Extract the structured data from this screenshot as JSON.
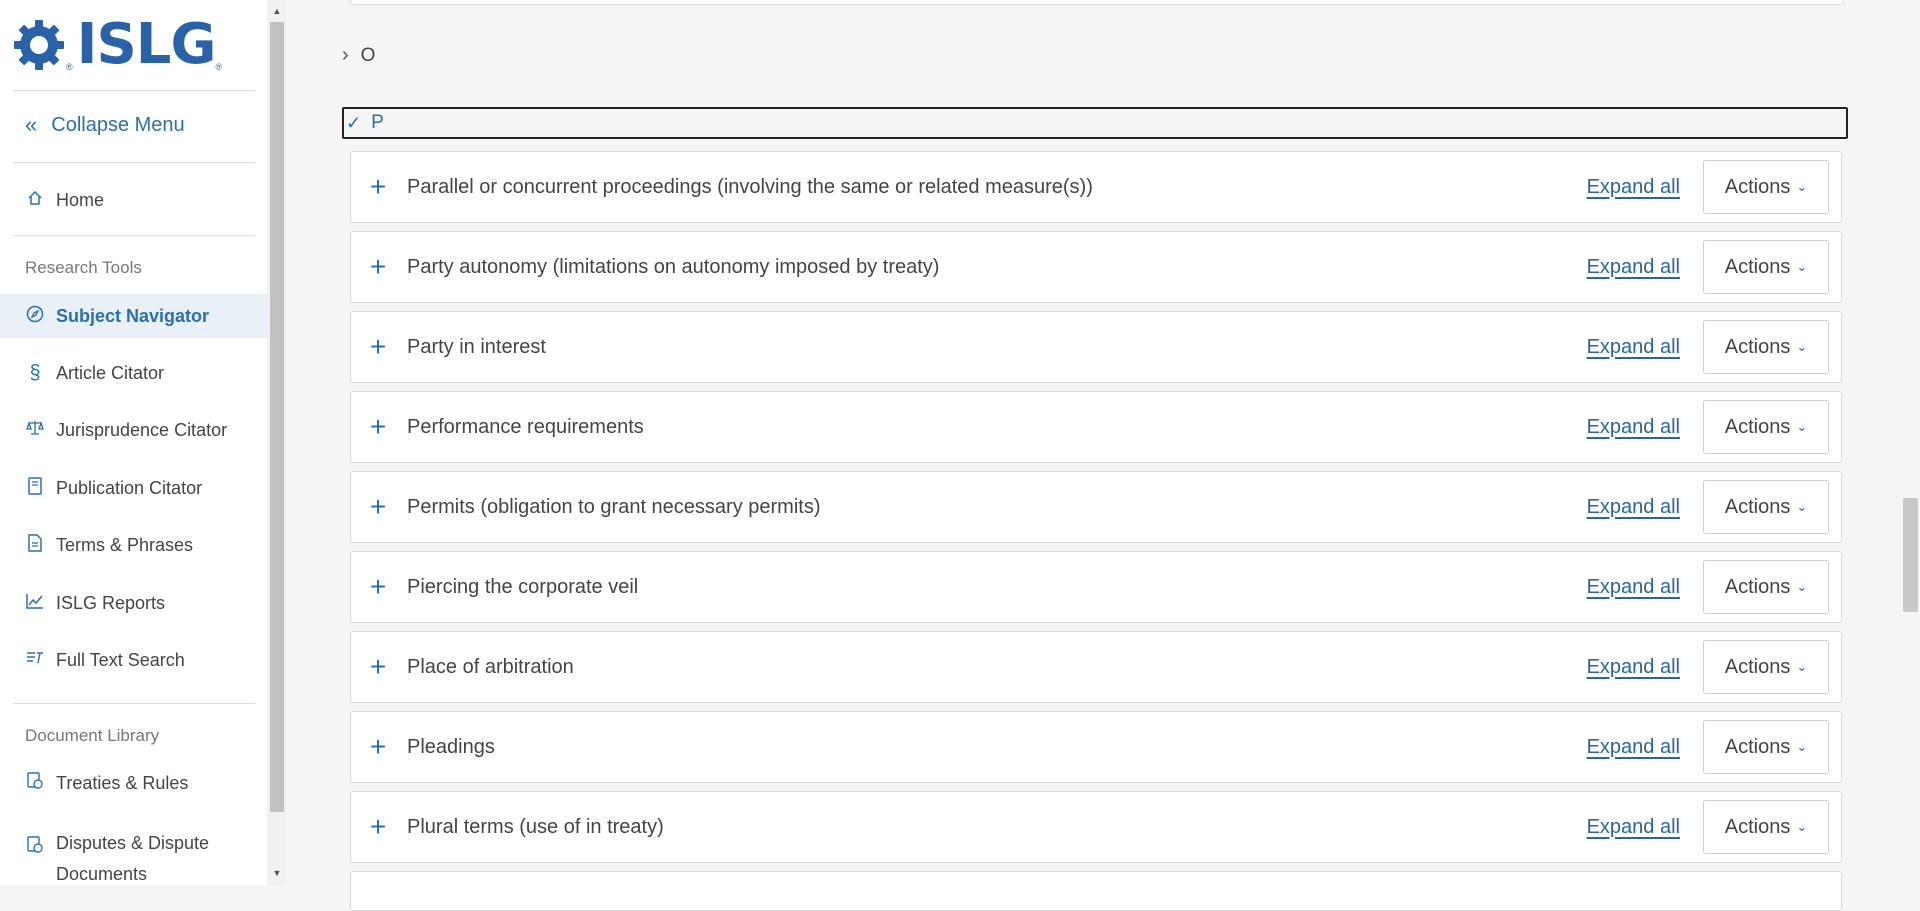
{
  "brand": {
    "name": "ISLG",
    "reg": "®"
  },
  "sidebar": {
    "collapse_label": "Collapse Menu",
    "home_label": "Home",
    "research_tools_label": "Research Tools",
    "items": [
      {
        "label": "Subject Navigator",
        "icon": "compass-icon"
      },
      {
        "label": "Article Citator",
        "icon": "section-icon"
      },
      {
        "label": "Jurisprudence Citator",
        "icon": "scales-icon"
      },
      {
        "label": "Publication Citator",
        "icon": "book-icon"
      },
      {
        "label": "Terms & Phrases",
        "icon": "document-icon"
      },
      {
        "label": "ISLG Reports",
        "icon": "chart-line-icon"
      },
      {
        "label": "Full Text Search",
        "icon": "text-search-icon"
      }
    ],
    "document_library_label": "Document Library",
    "library_items": [
      {
        "label": "Treaties & Rules",
        "icon": "treaties-icon"
      },
      {
        "label": "Disputes & Dispute Documents",
        "icon": "disputes-icon"
      }
    ]
  },
  "letters": {
    "o": "O",
    "p": "P"
  },
  "topics": [
    {
      "label": "Parallel or concurrent proceedings (involving the same or related measure(s))"
    },
    {
      "label": "Party autonomy (limitations on autonomy imposed by treaty)"
    },
    {
      "label": "Party in interest"
    },
    {
      "label": "Performance requirements"
    },
    {
      "label": "Permits (obligation to grant necessary permits)"
    },
    {
      "label": "Piercing the corporate veil"
    },
    {
      "label": "Place of arbitration"
    },
    {
      "label": "Pleadings"
    },
    {
      "label": "Plural terms (use of in treaty)"
    }
  ],
  "row_controls": {
    "expand_label": "Expand all",
    "actions_label": "Actions"
  },
  "colors": {
    "accent": "#2a6fb2",
    "brand": "#2a62a8"
  }
}
